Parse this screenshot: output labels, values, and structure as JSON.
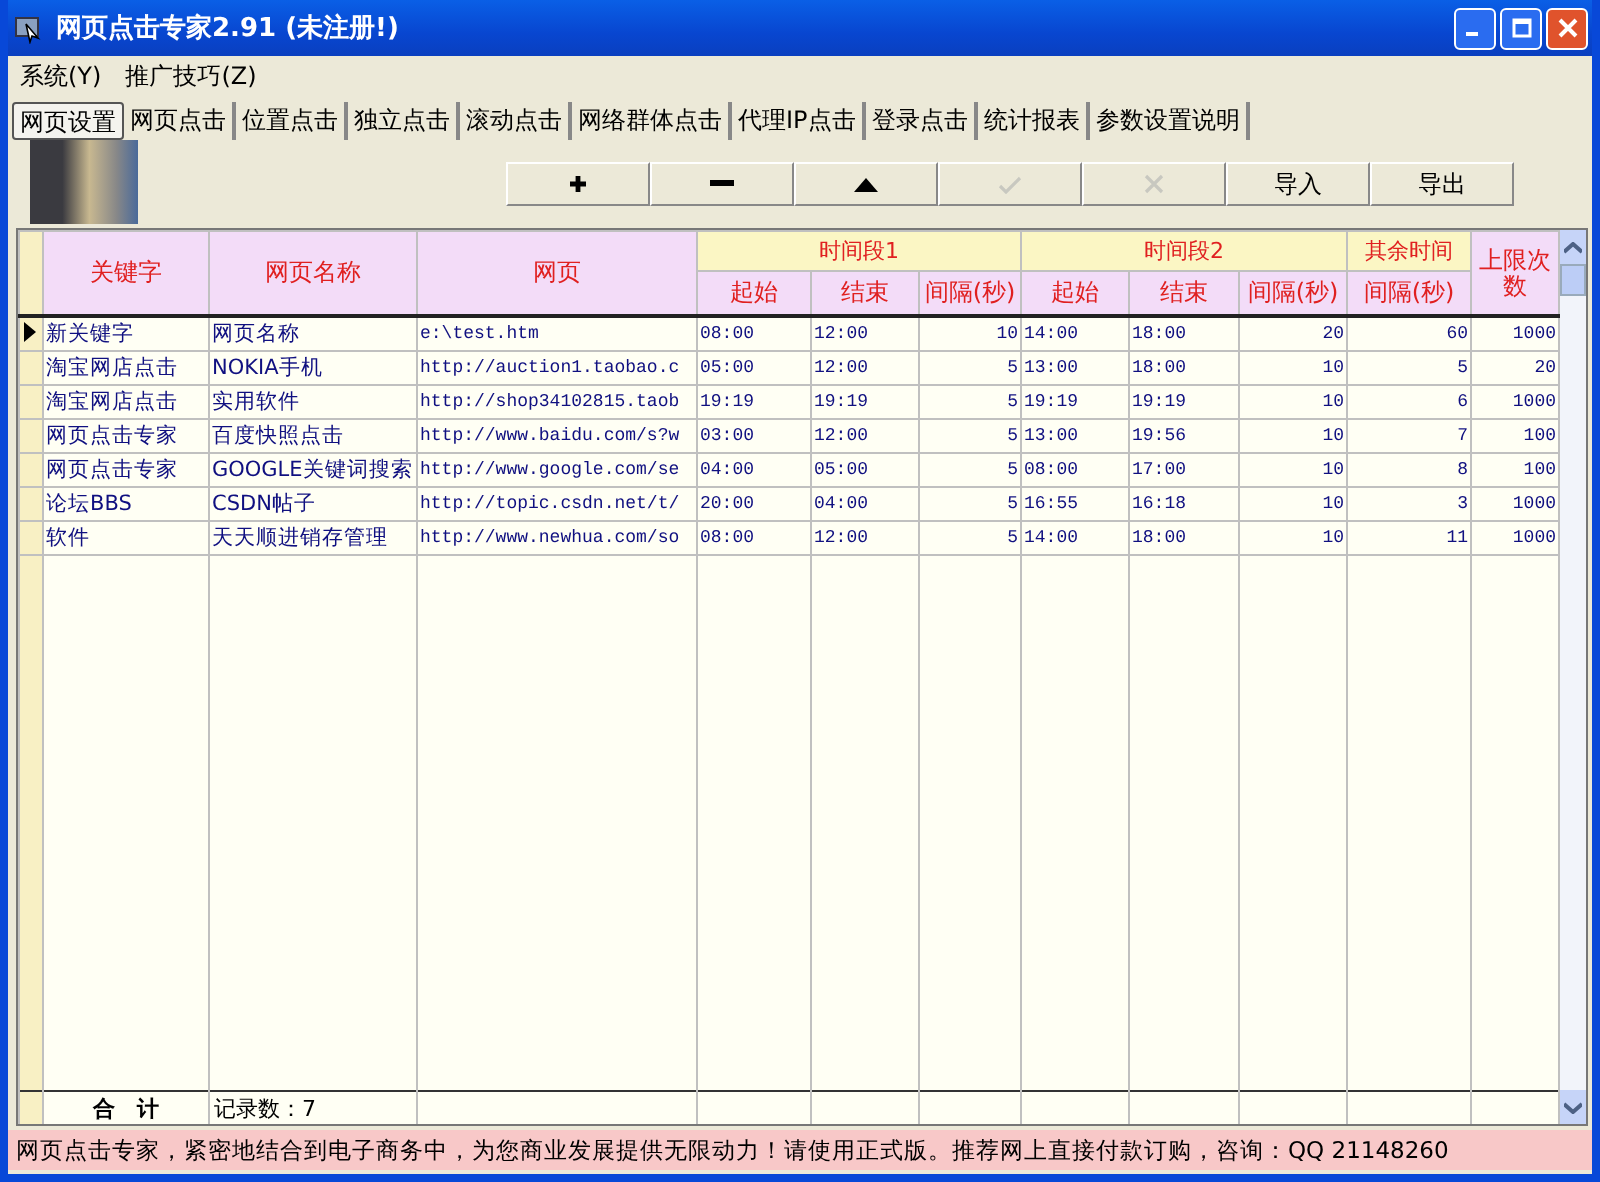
{
  "window": {
    "title": "网页点击专家2.91 (未注册!)"
  },
  "menu": [
    "系统(Y)",
    "推广技巧(Z)"
  ],
  "tabs": [
    {
      "label": "网页设置",
      "selected": true
    },
    {
      "label": "网页点击",
      "selected": false
    },
    {
      "label": "位置点击",
      "selected": false
    },
    {
      "label": "独立点击",
      "selected": false
    },
    {
      "label": "滚动点击",
      "selected": false
    },
    {
      "label": "网络群体点击",
      "selected": false
    },
    {
      "label": "代理IP点击",
      "selected": false
    },
    {
      "label": "登录点击",
      "selected": false
    },
    {
      "label": "统计报表",
      "selected": false
    },
    {
      "label": "参数设置说明",
      "selected": false
    }
  ],
  "toolbar": [
    {
      "kind": "add",
      "disabled": false
    },
    {
      "kind": "remove",
      "disabled": false
    },
    {
      "kind": "up",
      "disabled": false
    },
    {
      "kind": "confirm",
      "disabled": true
    },
    {
      "kind": "cancel",
      "disabled": true
    },
    {
      "kind": "text",
      "label": "导入",
      "disabled": false
    },
    {
      "kind": "text",
      "label": "导出",
      "disabled": false
    }
  ],
  "table": {
    "columns": [
      "关键字",
      "网页名称",
      "网页"
    ],
    "groups": [
      {
        "label": "时间段1",
        "columns": [
          "起始",
          "结束",
          "间隔(秒)"
        ]
      },
      {
        "label": "时间段2",
        "columns": [
          "起始",
          "结束",
          "间隔(秒)"
        ]
      },
      {
        "label": "其余时间",
        "columns": [
          "间隔(秒)"
        ]
      }
    ],
    "last_column": "上限次数",
    "rows": [
      {
        "current": true,
        "cells": [
          "新关键字",
          "网页名称",
          "e:\\test.htm",
          "08:00",
          "12:00",
          "10",
          "14:00",
          "18:00",
          "20",
          "60",
          "1000"
        ]
      },
      {
        "current": false,
        "cells": [
          "淘宝网店点击",
          "NOKIA手机",
          "http://auction1.taobao.c",
          "05:00",
          "12:00",
          "5",
          "13:00",
          "18:00",
          "10",
          "5",
          "20"
        ]
      },
      {
        "current": false,
        "cells": [
          "淘宝网店点击",
          "实用软件",
          "http://shop34102815.taob",
          "19:19",
          "19:19",
          "5",
          "19:19",
          "19:19",
          "10",
          "6",
          "1000"
        ]
      },
      {
        "current": false,
        "cells": [
          "网页点击专家",
          "百度快照点击",
          "http://www.baidu.com/s?w",
          "03:00",
          "12:00",
          "5",
          "13:00",
          "19:56",
          "10",
          "7",
          "100"
        ]
      },
      {
        "current": false,
        "cells": [
          "网页点击专家",
          "GOOGLE关键词搜索",
          "http://www.google.com/se",
          "04:00",
          "05:00",
          "5",
          "08:00",
          "17:00",
          "10",
          "8",
          "100"
        ]
      },
      {
        "current": false,
        "cells": [
          "论坛BBS",
          "CSDN帖子",
          "http://topic.csdn.net/t/",
          "20:00",
          "04:00",
          "5",
          "16:55",
          "16:18",
          "10",
          "3",
          "1000"
        ]
      },
      {
        "current": false,
        "cells": [
          "软件",
          "天天顺进销存管理",
          "http://www.newhua.com/so",
          "08:00",
          "12:00",
          "5",
          "14:00",
          "18:00",
          "10",
          "11",
          "1000"
        ]
      }
    ],
    "footer": [
      "合　计",
      "记录数：7"
    ]
  },
  "status_bar": "网页点击专家，紧密地结合到电子商务中，为您商业发展提供无限动力！请使用正式版。推荐网上直接付款订购，咨询：QQ 21148260"
}
